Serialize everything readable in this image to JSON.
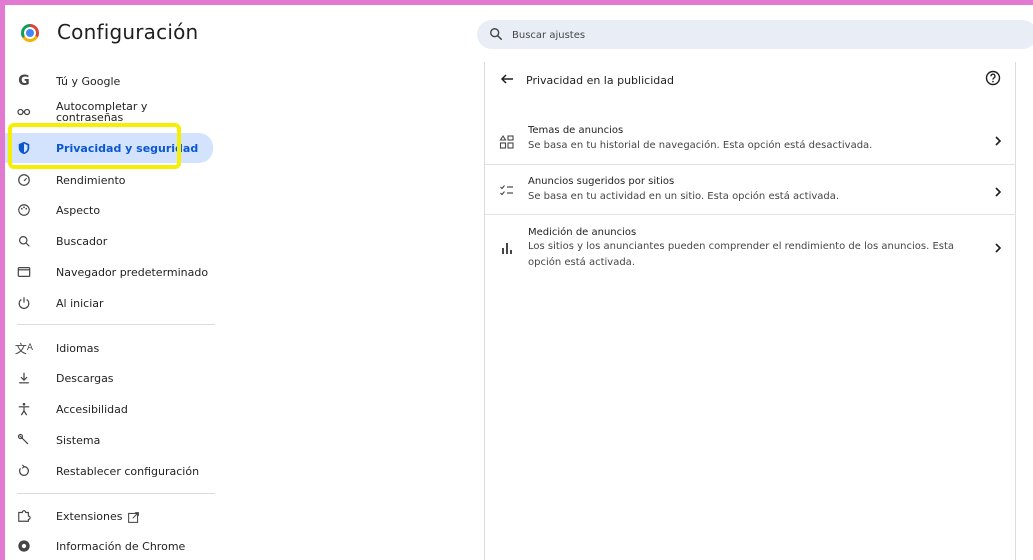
{
  "app": {
    "title": "Configuración"
  },
  "search": {
    "placeholder": "Buscar ajustes"
  },
  "sidebar": {
    "items": [
      {
        "label": "Tú y Google",
        "icon": "google-g-icon"
      },
      {
        "label": "Autocompletar y\ncontraseñas",
        "icon": "key-icon"
      },
      {
        "label": "Privacidad y seguridad",
        "icon": "shield-icon",
        "selected": true
      },
      {
        "label": "Rendimiento",
        "icon": "speedometer-icon"
      },
      {
        "label": "Aspecto",
        "icon": "palette-icon"
      },
      {
        "label": "Buscador",
        "icon": "search-icon"
      },
      {
        "label": "Navegador predeterminado",
        "icon": "browser-window-icon"
      },
      {
        "label": "Al iniciar",
        "icon": "power-icon"
      },
      {
        "label": "Idiomas",
        "icon": "translate-icon"
      },
      {
        "label": "Descargas",
        "icon": "download-icon"
      },
      {
        "label": "Accesibilidad",
        "icon": "accessibility-icon"
      },
      {
        "label": "Sistema",
        "icon": "wrench-icon"
      },
      {
        "label": "Restablecer configuración",
        "icon": "reset-icon"
      },
      {
        "label": "Extensiones",
        "icon": "puzzle-icon"
      },
      {
        "label": "Información de Chrome",
        "icon": "chrome-info-icon"
      }
    ]
  },
  "panel": {
    "title": "Privacidad en la publicidad",
    "rows": [
      {
        "title": "Temas de anuncios",
        "subtitle": "Se basa en tu historial de navegación. Esta opción está desactivada.",
        "icon": "topics-icon"
      },
      {
        "title": "Anuncios sugeridos por sitios",
        "subtitle": "Se basa en tu actividad en un sitio. Esta opción está activada.",
        "icon": "checklist-icon"
      },
      {
        "title": "Medición de anuncios",
        "subtitle": "Los sitios y los anunciantes pueden comprender el rendimiento de los anuncios. Esta opción está activada.",
        "icon": "bar-chart-icon"
      }
    ]
  },
  "colors": {
    "accent": "#0b57d0",
    "selected_bg": "#d3e3fd",
    "frame": "#e27ad1",
    "highlight": "#f5f003"
  }
}
